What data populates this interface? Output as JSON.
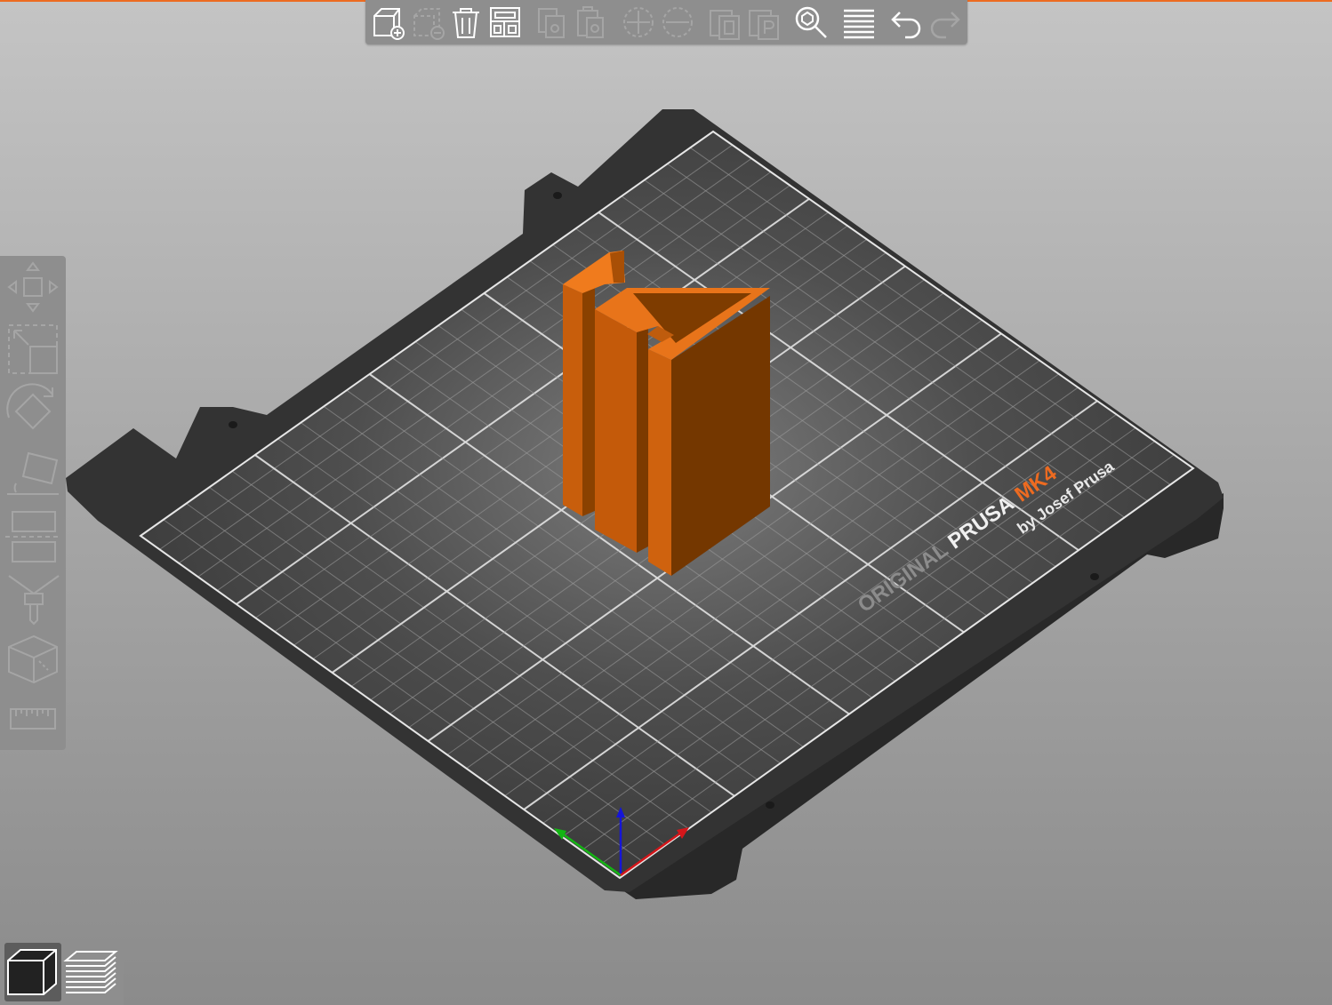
{
  "app": {
    "accent_color": "#ed6b21"
  },
  "top_toolbar": {
    "buttons": [
      {
        "name": "add-icon",
        "enabled": true
      },
      {
        "name": "delete-icon",
        "enabled": false
      },
      {
        "name": "delete-all-icon",
        "enabled": true
      },
      {
        "name": "arrange-icon",
        "enabled": true
      },
      {
        "name": "copy-icon",
        "enabled": false
      },
      {
        "name": "paste-icon",
        "enabled": false
      },
      {
        "name": "add-instance-icon",
        "enabled": false
      },
      {
        "name": "remove-instance-icon",
        "enabled": false
      },
      {
        "name": "split-to-objects-icon",
        "enabled": false
      },
      {
        "name": "split-to-parts-icon",
        "enabled": false
      },
      {
        "name": "search-icon",
        "enabled": true
      },
      {
        "name": "layers-editing-icon",
        "enabled": true
      },
      {
        "name": "undo-icon",
        "enabled": true
      },
      {
        "name": "redo-icon",
        "enabled": false
      }
    ]
  },
  "left_toolbar": {
    "tools": [
      "move-icon",
      "scale-icon",
      "rotate-icon",
      "place-on-face-icon",
      "cut-icon",
      "paint-icon",
      "seam-icon",
      "measure-icon"
    ]
  },
  "view_toggle": {
    "active": "3d-view",
    "views": [
      "3d-view-icon",
      "preview-layers-icon"
    ]
  },
  "bed": {
    "brand_prefix": "ORIGINAL",
    "brand_name": "PRUSA",
    "model": "MK4",
    "maker": "by Josef Prusa"
  },
  "model_object": {
    "color": "#e27014"
  },
  "axes": {
    "x_color": "#d4161a",
    "y_color": "#13b513",
    "z_color": "#1515d8"
  }
}
